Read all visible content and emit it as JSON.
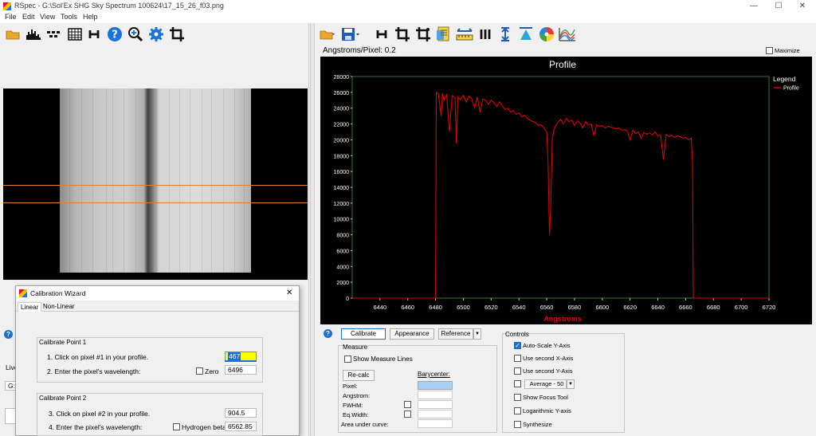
{
  "window": {
    "title": "RSpec - G:\\Sol'Ex SHG Sky Spectrum 100624\\17_15_26_f03.png",
    "min": "—",
    "max": "☐",
    "close": "✕"
  },
  "menu": [
    "File",
    "Edit",
    "View",
    "Tools",
    "Help"
  ],
  "left_toolbar": [
    "open-folder-icon",
    "histogram-icon",
    "binning-icon",
    "grid-icon",
    "h-icon",
    "help-icon",
    "zoom-icon",
    "settings-icon",
    "crop-icon"
  ],
  "right_toolbar": [
    "open-folder-icon",
    "save-icon",
    "h-icon",
    "crop-icon",
    "crop-alt-icon",
    "notes-icon",
    "ruler-icon",
    "lines-icon",
    "vertical-arrows-icon",
    "filter-icon",
    "color-wheel-icon",
    "spectra-icon"
  ],
  "angstroms_per_pixel": "Angstroms/Pixel: 0.2",
  "maximize_label": "Maximize",
  "left_stub": {
    "live_label": "Live",
    "g_label": "G:\\"
  },
  "wizard": {
    "title": "Calibration Wizard",
    "close": "✕",
    "tabs": [
      "Linear",
      "Non-Linear"
    ],
    "point1": {
      "title": "Calibrate Point 1",
      "step1": "1. Click on pixel #1 in your profile.",
      "pixel_value": "467",
      "step2": "2. Enter the pixel's wavelength:",
      "zero_label": "Zero",
      "wavelength": "6496"
    },
    "point2": {
      "title": "Calibrate Point 2",
      "step3": "3. Click on pixel #2 in your profile.",
      "pixel_value": "904.5",
      "step4": "4. Enter the  pixel's wavelength:",
      "hbeta_label": "Hydrogen beta",
      "wavelength": "6562.85"
    }
  },
  "bottom": {
    "calibrate": "Calibrate",
    "appearance": "Appearance",
    "reference": "Reference",
    "measure_title": "Measure",
    "show_measure_lines": "Show Measure Lines",
    "recalc": "Re-calc",
    "barycenter": "Barycenter:",
    "pixel": "Pixel:",
    "angstrom": "Angstrom:",
    "fwhm": "FWHM:",
    "eqwidth": "Eq.Width:",
    "area": "Area under curve:",
    "controls_title": "Controls",
    "auto_scale": "Auto-Scale Y-Axis",
    "use_second_x": "Use second X-Axis",
    "use_second_y": "Use second Y-Axis",
    "average": "Average - 50",
    "show_focus": "Show Focus Tool",
    "log_y": "Logarithmic Y-axis",
    "synthesize": "Synthesize"
  },
  "colors": {
    "profile": "#e00000",
    "plot_bg": "#000000",
    "axis_label": "#e00000",
    "frame": "#2e7d32"
  },
  "chart_data": {
    "type": "line",
    "title": "Profile",
    "xlabel": "Angstroms",
    "ylabel": "",
    "xlim": [
      6420,
      6720
    ],
    "ylim": [
      0,
      28000
    ],
    "xticks": [
      6440,
      6460,
      6480,
      6500,
      6520,
      6540,
      6560,
      6580,
      6600,
      6620,
      6640,
      6660,
      6680,
      6700,
      6720
    ],
    "yticks": [
      0,
      2000,
      4000,
      6000,
      8000,
      10000,
      12000,
      14000,
      16000,
      18000,
      20000,
      22000,
      24000,
      26000,
      28000
    ],
    "legend_title": "Legend",
    "legend_position": "top-right",
    "series": [
      {
        "name": "Profile",
        "x": [
          6480,
          6480.5,
          6482,
          6484,
          6485,
          6486,
          6488,
          6490,
          6492,
          6494,
          6495,
          6496,
          6498,
          6500,
          6502,
          6504,
          6506,
          6508,
          6510,
          6512,
          6514,
          6516,
          6518,
          6520,
          6522,
          6524,
          6526,
          6528,
          6530,
          6532,
          6534,
          6536,
          6538,
          6540,
          6542,
          6544,
          6546,
          6548,
          6550,
          6552,
          6554,
          6556,
          6558,
          6560,
          6561,
          6562,
          6562.8,
          6563.5,
          6564,
          6565,
          6566,
          6568,
          6570,
          6572,
          6574,
          6576,
          6578,
          6580,
          6582,
          6584,
          6586,
          6588,
          6590,
          6592,
          6594,
          6596,
          6598,
          6600,
          6602,
          6604,
          6606,
          6608,
          6610,
          6612,
          6614,
          6616,
          6618,
          6620,
          6622,
          6624,
          6626,
          6628,
          6630,
          6632,
          6634,
          6636,
          6638,
          6640,
          6642,
          6644,
          6646,
          6648,
          6650,
          6652,
          6654,
          6656,
          6658,
          6660,
          6662,
          6664,
          6665,
          6665.5
        ],
        "y": [
          0,
          26000,
          25800,
          23000,
          25900,
          25000,
          25700,
          21000,
          25600,
          25300,
          19500,
          25400,
          25100,
          25600,
          24800,
          25500,
          25200,
          24000,
          25400,
          23500,
          25200,
          25000,
          24500,
          25000,
          24700,
          24200,
          24800,
          24300,
          23800,
          24000,
          23500,
          23700,
          23200,
          23400,
          22900,
          23100,
          22700,
          22500,
          22300,
          22200,
          21800,
          21900,
          21500,
          21000,
          17000,
          8000,
          11000,
          16000,
          20000,
          21200,
          21600,
          22200,
          22600,
          22000,
          22700,
          22300,
          22500,
          21800,
          22400,
          22100,
          21500,
          22300,
          21900,
          22000,
          20500,
          21900,
          21700,
          21800,
          21500,
          21700,
          21600,
          21500,
          21400,
          21500,
          21200,
          21300,
          21100,
          20000,
          21200,
          20800,
          21000,
          20200,
          20900,
          20700,
          20900,
          20600,
          21000,
          20500,
          20600,
          17500,
          20700,
          20400,
          20600,
          20300,
          20500,
          20400,
          20200,
          20300,
          20000,
          20200,
          17000,
          0
        ]
      }
    ]
  }
}
